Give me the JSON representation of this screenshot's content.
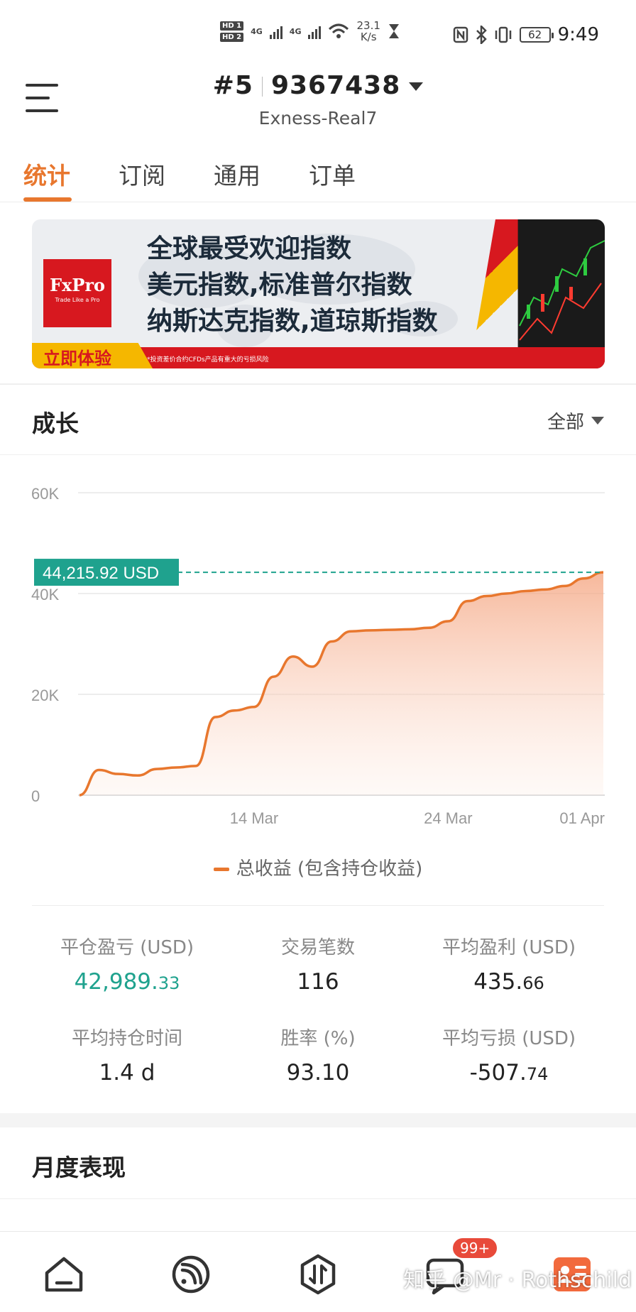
{
  "status_bar": {
    "hd1": "HD 1",
    "hd2": "HD 2",
    "net1": "4G",
    "net2": "4G",
    "speed_value": "23.1",
    "speed_unit": "K/s",
    "battery": "62",
    "time": "9:49"
  },
  "header": {
    "account_rank": "#5",
    "account_number": "9367438",
    "server": "Exness-Real7"
  },
  "tabs": [
    "统计",
    "订阅",
    "通用",
    "订单"
  ],
  "banner": {
    "brand": "FxPro",
    "brand_tagline": "Trade Like a Pro",
    "lines": [
      "全球最受欢迎指数",
      "美元指数,标准普尔指数",
      "纳斯达克指数,道琼斯指数"
    ],
    "cta": "立即体验",
    "note": "*投资差价合约CFDs产品有重大的亏损风险"
  },
  "growth": {
    "title": "成长",
    "range": "全部",
    "legend": "总收益 (包含持仓收益)"
  },
  "chart_data": {
    "type": "area",
    "x": [
      "03-05",
      "03-06",
      "03-07",
      "03-08",
      "03-09",
      "03-10",
      "03-11",
      "03-12",
      "03-13",
      "03-14",
      "03-15",
      "03-16",
      "03-17",
      "03-18",
      "03-19",
      "03-20",
      "03-21",
      "03-22",
      "03-23",
      "03-24",
      "03-25",
      "03-26",
      "03-27",
      "03-28",
      "03-29",
      "03-30",
      "03-31",
      "04-01"
    ],
    "y": [
      0,
      5000,
      4200,
      3900,
      5200,
      5500,
      5800,
      15500,
      16800,
      17500,
      23500,
      27500,
      25500,
      30500,
      32500,
      32700,
      32800,
      32900,
      33200,
      34500,
      38500,
      39500,
      40000,
      40500,
      40800,
      41500,
      43000,
      44215.92
    ],
    "xticks": [
      "14 Mar",
      "24 Mar",
      "01 Apr"
    ],
    "yticks": [
      "0",
      "20K",
      "40K",
      "60K"
    ],
    "ylim": [
      0,
      60000
    ],
    "current_label": "44,215.92 USD",
    "series_color": "#e8772e",
    "marker_color": "#1fa28e",
    "grid": true
  },
  "stats": [
    {
      "label": "平仓盈亏 (USD)",
      "value_main": "42,989.",
      "value_minor": "33"
    },
    {
      "label": "交易笔数",
      "value_main": "116",
      "value_minor": ""
    },
    {
      "label": "平均盈利 (USD)",
      "value_main": "435.",
      "value_minor": "66"
    },
    {
      "label": "平均持仓时间",
      "value_main": "1.4 d",
      "value_minor": ""
    },
    {
      "label": "胜率 (%)",
      "value_main": "93.10",
      "value_minor": ""
    },
    {
      "label": "平均亏损 (USD)",
      "value_main": "-507.",
      "value_minor": "74"
    }
  ],
  "monthly": {
    "title": "月度表现"
  },
  "bottom_nav": {
    "badge": "99+",
    "watermark": "知乎 @Mr · Rothschild"
  }
}
